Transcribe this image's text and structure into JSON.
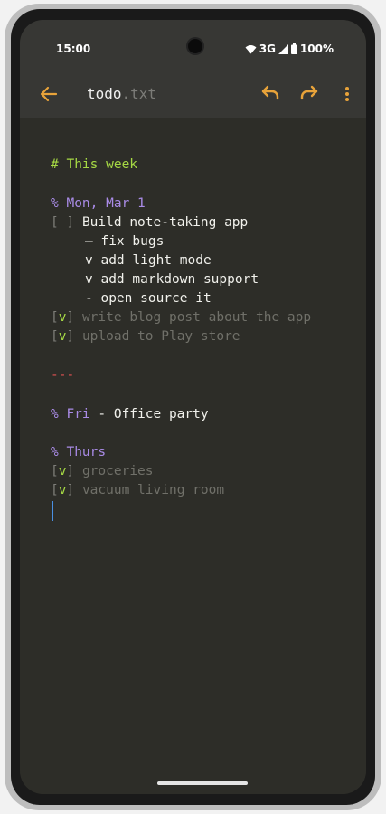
{
  "status_bar": {
    "time": "15:00",
    "network": "3G",
    "battery": "100%"
  },
  "app_bar": {
    "title_name": "todo",
    "title_ext": ".txt"
  },
  "editor": {
    "heading": "# This week",
    "section1_date": "% Mon, Mar 1",
    "task1_box": "[ ]",
    "task1_text": "Build note-taking app",
    "sub1": "– fix bugs",
    "sub2": "v add light mode",
    "sub3": "v add markdown support",
    "sub4": "- open source it",
    "task2_open": "[",
    "task2_check": "v",
    "task2_close": "]",
    "task2_text": "write blog post about the app",
    "task3_open": "[",
    "task3_check": "v",
    "task3_close": "]",
    "task3_text": "upload to Play store",
    "separator": "---",
    "section2_date": "% Fri",
    "section2_rest": " - Office party",
    "section3_date": "% Thurs",
    "task4_open": "[",
    "task4_check": "v",
    "task4_close": "]",
    "task4_text": "groceries",
    "task5_open": "[",
    "task5_check": "v",
    "task5_close": "]",
    "task5_text": "vacuum living room"
  },
  "colors": {
    "accent": "#e8a33a",
    "heading": "#a6d944",
    "date": "#a98be6",
    "separator": "#e05252",
    "cursor": "#4a90e2"
  },
  "icons": {
    "back": "arrow-back-icon",
    "undo": "undo-icon",
    "redo": "redo-icon",
    "more": "more-vert-icon"
  }
}
